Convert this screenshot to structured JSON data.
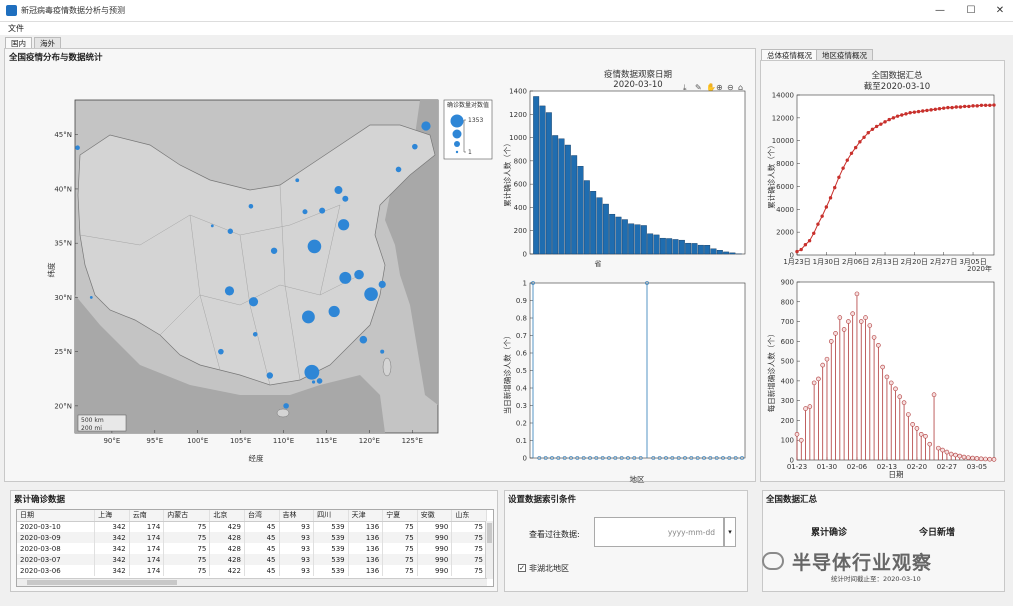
{
  "window": {
    "title": "新冠病毒疫情数据分析与预测",
    "min": "—",
    "max": "☐",
    "close": "✕"
  },
  "menu": {
    "file": "文件"
  },
  "tabs": {
    "domestic": "国内",
    "overseas": "海外"
  },
  "right_tabs": {
    "overall": "总体疫情概况",
    "regional": "地区疫情概况"
  },
  "main": {
    "title": "全国疫情分布与数据统计"
  },
  "map": {
    "xlabel": "经度",
    "ylabel": "纬度",
    "xticks": [
      "90°E",
      "95°E",
      "100°E",
      "105°E",
      "110°E",
      "115°E",
      "120°E",
      "125°E"
    ],
    "yticks": [
      "45°N",
      "40°N",
      "35°N",
      "30°N",
      "25°N",
      "20°N"
    ],
    "scale": [
      "500 km",
      "200 mi"
    ],
    "legend": {
      "title": "确诊数量对数值",
      "max": "1353",
      "min": "1"
    },
    "points": [
      {
        "lon": 86,
        "lat": 43.8,
        "r": 2.3
      },
      {
        "lon": 87.6,
        "lat": 30,
        "r": 1.4
      },
      {
        "lon": 101.7,
        "lat": 36.6,
        "r": 1.4
      },
      {
        "lon": 103.8,
        "lat": 36.1,
        "r": 2.7
      },
      {
        "lon": 106.2,
        "lat": 38.4,
        "r": 2.3
      },
      {
        "lon": 108.9,
        "lat": 34.3,
        "r": 3.2
      },
      {
        "lon": 111.6,
        "lat": 40.8,
        "r": 1.9
      },
      {
        "lon": 112.5,
        "lat": 37.9,
        "r": 2.5
      },
      {
        "lon": 114.5,
        "lat": 38,
        "r": 3
      },
      {
        "lon": 116.4,
        "lat": 39.9,
        "r": 4
      },
      {
        "lon": 117.2,
        "lat": 39.1,
        "r": 3
      },
      {
        "lon": 113.6,
        "lat": 34.7,
        "r": 6.8
      },
      {
        "lon": 117.2,
        "lat": 31.8,
        "r": 6
      },
      {
        "lon": 118.8,
        "lat": 32.1,
        "r": 4.8
      },
      {
        "lon": 120.2,
        "lat": 30.3,
        "r": 6.8
      },
      {
        "lon": 121.5,
        "lat": 31.2,
        "r": 3.6
      },
      {
        "lon": 117,
        "lat": 36.7,
        "r": 5.6
      },
      {
        "lon": 103.7,
        "lat": 30.6,
        "r": 4.6
      },
      {
        "lon": 106.5,
        "lat": 29.6,
        "r": 4.6
      },
      {
        "lon": 106.7,
        "lat": 26.6,
        "r": 2.3
      },
      {
        "lon": 102.7,
        "lat": 25,
        "r": 2.8
      },
      {
        "lon": 108.4,
        "lat": 22.8,
        "r": 3.2
      },
      {
        "lon": 113.3,
        "lat": 23.1,
        "r": 7.4
      },
      {
        "lon": 110.3,
        "lat": 20,
        "r": 2.8
      },
      {
        "lon": 112.9,
        "lat": 28.2,
        "r": 6.4
      },
      {
        "lon": 115.9,
        "lat": 28.7,
        "r": 5.6
      },
      {
        "lon": 119.3,
        "lat": 26.1,
        "r": 3.8
      },
      {
        "lon": 121.5,
        "lat": 25,
        "r": 2
      },
      {
        "lon": 114.2,
        "lat": 22.3,
        "r": 2.8
      },
      {
        "lon": 113.5,
        "lat": 22.2,
        "r": 1.6
      },
      {
        "lon": 126.6,
        "lat": 45.8,
        "r": 4.6
      },
      {
        "lon": 125.3,
        "lat": 43.9,
        "r": 2.8
      },
      {
        "lon": 123.4,
        "lat": 41.8,
        "r": 2.8
      }
    ]
  },
  "bar_chart": {
    "title": "疫情数据观察日期",
    "date": "2020-03-10",
    "ylabel": "累计确诊人数（个）",
    "xcat_label": "省",
    "chart_data": {
      "type": "bar",
      "yticks": [
        0,
        200,
        400,
        600,
        800,
        1000,
        1200,
        1400
      ],
      "values": [
        1353,
        1272,
        1215,
        1018,
        990,
        936,
        846,
        754,
        631,
        539,
        484,
        429,
        342,
        318,
        296,
        260,
        252,
        245,
        174,
        164,
        136,
        133,
        125,
        119,
        93,
        91,
        76,
        75,
        45,
        32,
        18,
        10,
        1
      ]
    }
  },
  "stem_chart": {
    "ylabel": "当日新增确诊人数（个）",
    "xlabel": "地区",
    "chart_data": {
      "type": "scatter",
      "yticks": [
        "0",
        "0.1",
        "0.2",
        "0.3",
        "0.4",
        "0.5",
        "0.6",
        "0.7",
        "0.8",
        "0.9",
        "1"
      ],
      "values": [
        1,
        0,
        0,
        0,
        0,
        0,
        0,
        0,
        0,
        0,
        0,
        0,
        0,
        0,
        0,
        0,
        0,
        0,
        1,
        0,
        0,
        0,
        0,
        0,
        0,
        0,
        0,
        0,
        0,
        0,
        0,
        0,
        0,
        0
      ]
    }
  },
  "line_chart": {
    "title": "全国数据汇总",
    "subtitle": "截至2020-03-10",
    "ylabel": "累计确诊人数（个）",
    "xticks": [
      "1月23日",
      "1月30日",
      "2月06日",
      "2月13日",
      "2月20日",
      "2月27日",
      "3月05日"
    ],
    "year_label": "2020年",
    "chart_data": {
      "type": "line",
      "yticks": [
        0,
        2000,
        4000,
        6000,
        8000,
        10000,
        12000,
        14000
      ],
      "values": [
        300,
        480,
        900,
        1250,
        1900,
        2700,
        3400,
        4200,
        5000,
        5900,
        6800,
        7600,
        8300,
        8900,
        9400,
        9900,
        10300,
        10700,
        11000,
        11250,
        11450,
        11650,
        11850,
        12000,
        12150,
        12250,
        12350,
        12450,
        12500,
        12550,
        12600,
        12650,
        12700,
        12750,
        12800,
        12850,
        12900,
        12900,
        12950,
        12950,
        13000,
        13000,
        13050,
        13050,
        13100,
        13100,
        13100,
        13120
      ]
    }
  },
  "new_chart": {
    "ylabel": "每日新增确诊人数（个）",
    "xlabel": "日期",
    "xticks": [
      "01-23",
      "01-30",
      "02-06",
      "02-13",
      "02-20",
      "02-27",
      "03-05"
    ],
    "chart_data": {
      "type": "scatter",
      "yticks": [
        0,
        100,
        200,
        300,
        400,
        500,
        600,
        700,
        800,
        900
      ],
      "values": [
        130,
        100,
        260,
        270,
        390,
        410,
        480,
        510,
        600,
        640,
        720,
        660,
        700,
        740,
        840,
        700,
        720,
        680,
        620,
        580,
        470,
        420,
        390,
        360,
        320,
        290,
        230,
        180,
        160,
        130,
        120,
        80,
        330,
        60,
        50,
        40,
        30,
        25,
        20,
        15,
        12,
        10,
        8,
        6,
        5,
        4,
        3
      ]
    }
  },
  "table": {
    "title": "累计确诊数据",
    "headers": [
      "日期",
      "上海",
      "云南",
      "内蒙古",
      "北京",
      "台湾",
      "吉林",
      "四川",
      "天津",
      "宁夏",
      "安徽",
      "山东"
    ],
    "rows": [
      [
        "2020-03-10",
        "342",
        "174",
        "75",
        "429",
        "45",
        "93",
        "539",
        "136",
        "75",
        "990",
        "75"
      ],
      [
        "2020-03-09",
        "342",
        "174",
        "75",
        "428",
        "45",
        "93",
        "539",
        "136",
        "75",
        "990",
        "75"
      ],
      [
        "2020-03-08",
        "342",
        "174",
        "75",
        "428",
        "45",
        "93",
        "539",
        "136",
        "75",
        "990",
        "75"
      ],
      [
        "2020-03-07",
        "342",
        "174",
        "75",
        "428",
        "45",
        "93",
        "539",
        "136",
        "75",
        "990",
        "75"
      ],
      [
        "2020-03-06",
        "342",
        "174",
        "75",
        "422",
        "45",
        "93",
        "539",
        "136",
        "75",
        "990",
        "75"
      ]
    ]
  },
  "settings": {
    "title": "设置数据索引条件",
    "view_label": "查看过往数据:",
    "date_placeholder": "yyyy-mm-dd",
    "checkbox_label": "非湖北地区"
  },
  "summary": {
    "title": "全国数据汇总",
    "cum_label": "累计确诊",
    "today_label": "今日新增",
    "stat_time": "统计时间截止至：2020-03-10"
  },
  "watermark": {
    "text": "半导体行业观察"
  },
  "colors": {
    "bar": "#1f6db0",
    "map_dot": "#2e86d6",
    "line": "#c8302c",
    "stem": "#b03a3a"
  }
}
